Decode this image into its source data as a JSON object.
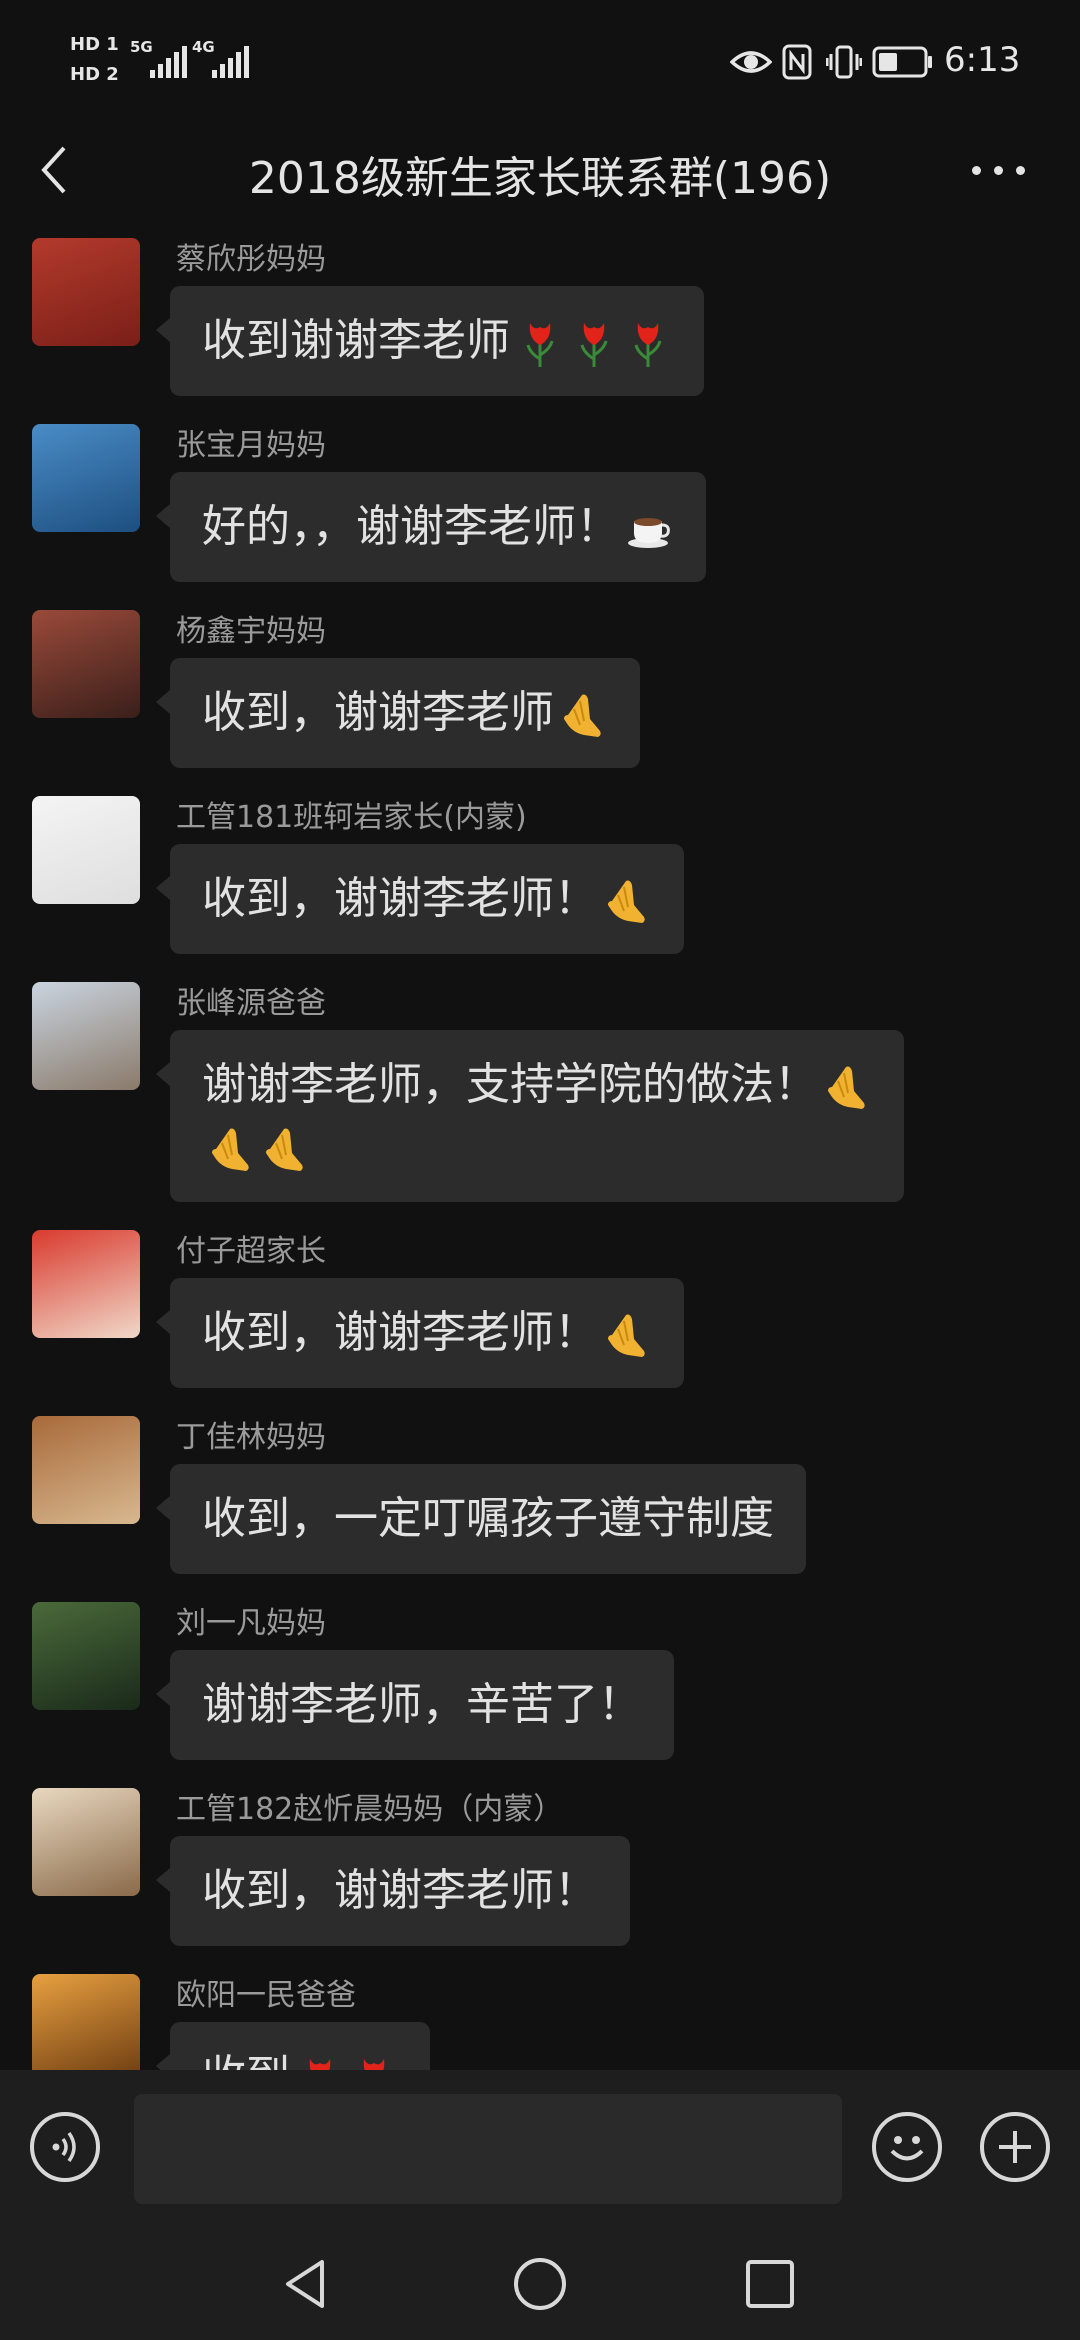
{
  "status_bar": {
    "hd1": "HD 1",
    "hd2": "HD 2",
    "net1": "5G",
    "net2": "4G",
    "time": "6:13",
    "icons": [
      "eye-icon",
      "nfc-icon",
      "vibrate-icon",
      "battery-icon"
    ]
  },
  "header": {
    "title": "2018级新生家长联系群(196)",
    "back_icon": "back-arrow-icon",
    "more_icon": "more-dots-icon"
  },
  "messages": [
    {
      "sender": "蔡欣彤妈妈",
      "lines": [
        "收到谢谢李老师"
      ],
      "emoji": [
        "tulip",
        "tulip",
        "tulip"
      ],
      "avatar_colors": [
        "#b33a2c",
        "#7a1f18"
      ]
    },
    {
      "sender": "张宝月妈妈",
      "lines": [
        "好的，，谢谢李老师！"
      ],
      "emoji": [
        "coffee"
      ],
      "avatar_colors": [
        "#4a8cc7",
        "#1d4f80"
      ]
    },
    {
      "sender": "杨鑫宇妈妈",
      "lines": [
        "收到，谢谢李老师"
      ],
      "emoji": [
        "pray"
      ],
      "avatar_colors": [
        "#9a4a3a",
        "#3a1f1a"
      ]
    },
    {
      "sender": "工管181班轲岩家长(内蒙)",
      "lines": [
        "收到，谢谢李老师！"
      ],
      "emoji": [
        "pray"
      ],
      "avatar_colors": [
        "#f4f4f4",
        "#dedede"
      ]
    },
    {
      "sender": "张峰源爸爸",
      "lines": [
        "谢谢李老师，支持学院的做法！",
        ""
      ],
      "emoji": [
        "pray"
      ],
      "emoji_line2": [
        "pray",
        "pray"
      ],
      "avatar_colors": [
        "#c9d4e0",
        "#8a7a6a"
      ]
    },
    {
      "sender": "付子超家长",
      "lines": [
        "收到，谢谢李老师！"
      ],
      "emoji": [
        "pray"
      ],
      "avatar_colors": [
        "#d93a2e",
        "#f0d8c8"
      ]
    },
    {
      "sender": "丁佳林妈妈",
      "lines": [
        "收到，一定叮嘱孩子遵守制度"
      ],
      "emoji": [],
      "avatar_colors": [
        "#a86a3a",
        "#d8b890"
      ]
    },
    {
      "sender": "刘一凡妈妈",
      "lines": [
        "谢谢李老师，辛苦了！"
      ],
      "emoji": [],
      "avatar_colors": [
        "#4a6a3a",
        "#1a2a1a"
      ]
    },
    {
      "sender": "工管182赵忻晨妈妈（内蒙）",
      "lines": [
        "收到，谢谢李老师！"
      ],
      "emoji": [],
      "avatar_colors": [
        "#e8d8c0",
        "#8a6a4a"
      ]
    },
    {
      "sender": "欧阳一民爸爸",
      "lines": [
        "收到"
      ],
      "emoji": [
        "tulip",
        "tulip"
      ],
      "avatar_colors": [
        "#e8a040",
        "#6a3a10"
      ]
    }
  ],
  "input_bar": {
    "voice_icon": "voice-icon",
    "input_placeholder": "",
    "emoji_icon": "emoji-icon",
    "add_icon": "plus-icon"
  },
  "nav_bar": {
    "back": "nav-back-icon",
    "home": "nav-home-icon",
    "recent": "nav-recent-icon"
  }
}
